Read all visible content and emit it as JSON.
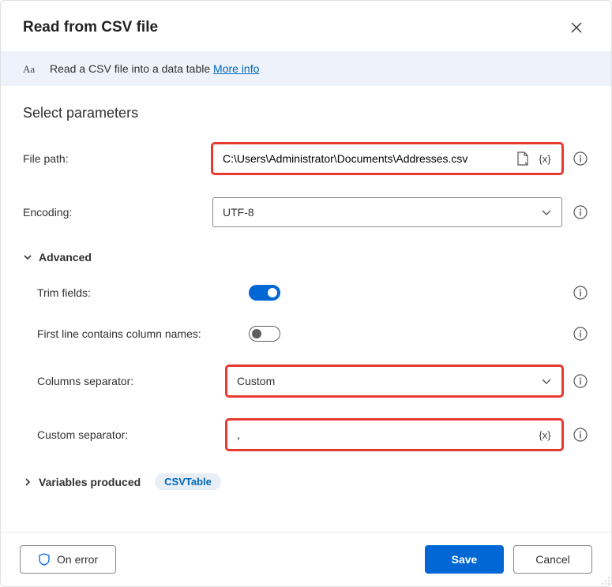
{
  "dialog": {
    "title": "Read from CSV file",
    "banner_text": "Read a CSV file into a data table ",
    "banner_link": "More info",
    "section_title": "Select parameters"
  },
  "fields": {
    "file_path_label": "File path:",
    "file_path_value": "C:\\Users\\Administrator\\Documents\\Addresses.csv",
    "encoding_label": "Encoding:",
    "encoding_value": "UTF-8",
    "advanced_label": "Advanced",
    "trim_fields_label": "Trim fields:",
    "first_line_label": "First line contains column names:",
    "columns_separator_label": "Columns separator:",
    "columns_separator_value": "Custom",
    "custom_separator_label": "Custom separator:",
    "custom_separator_value": ",",
    "variables_produced_label": "Variables produced",
    "variables_badge": "CSVTable"
  },
  "toggles": {
    "trim_fields": true,
    "first_line": false
  },
  "buttons": {
    "on_error": "On error",
    "save": "Save",
    "cancel": "Cancel"
  }
}
